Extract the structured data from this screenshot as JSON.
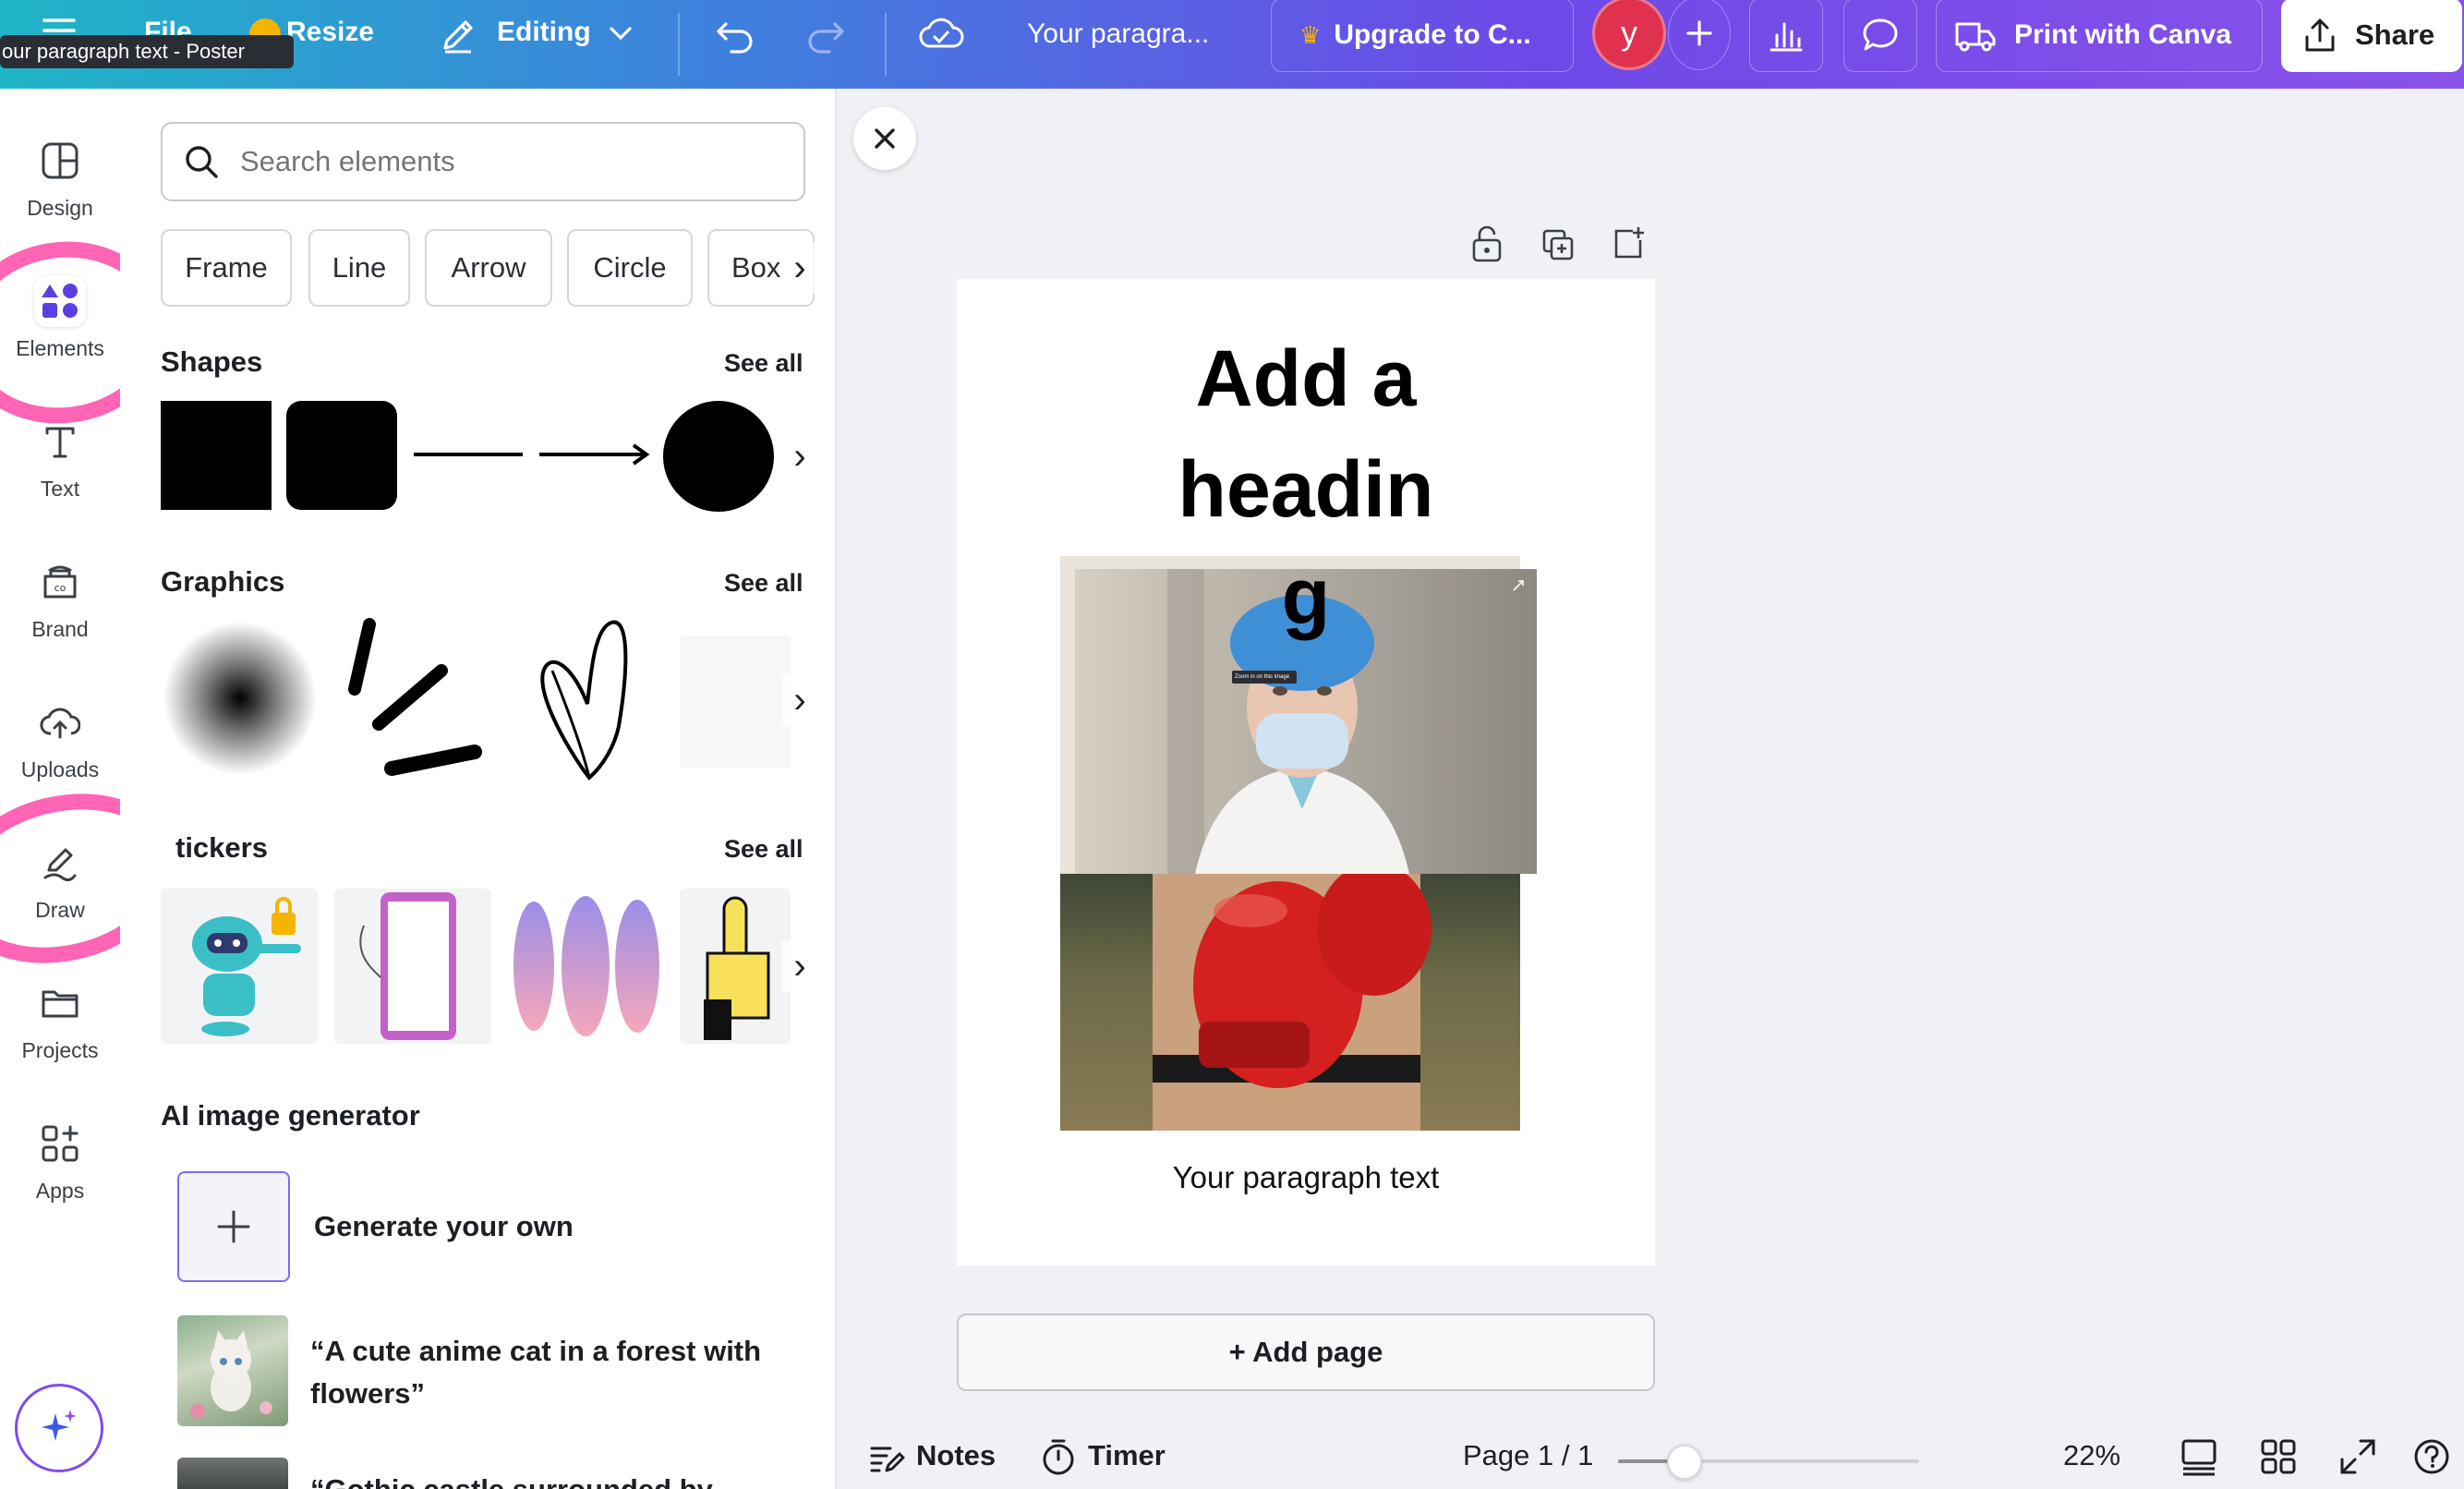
{
  "topbar": {
    "file_label": "File",
    "resize_label": "Resize",
    "editing_label": "Editing",
    "doc_title": "Your paragra...",
    "upgrade_label": "Upgrade to C...",
    "avatar_initial": "y",
    "print_label": "Print with Canva",
    "share_label": "Share",
    "tooltip": "our paragraph text - Poster"
  },
  "rail": {
    "items": [
      {
        "label": "Design"
      },
      {
        "label": "Elements"
      },
      {
        "label": "Text"
      },
      {
        "label": "Brand"
      },
      {
        "label": "Uploads"
      },
      {
        "label": "Draw"
      },
      {
        "label": "Projects"
      },
      {
        "label": "Apps"
      }
    ]
  },
  "panel": {
    "search_placeholder": "Search elements",
    "chips": [
      "Frame",
      "Line",
      "Arrow",
      "Circle",
      "Box"
    ],
    "sections": {
      "shapes": "Shapes",
      "graphics": "Graphics",
      "stickers": "tickers",
      "ai": "AI image generator"
    },
    "see_all": "See all",
    "ai_items": [
      {
        "label": "Generate your own"
      },
      {
        "label": "“A cute anime cat in a forest with flowers”"
      },
      {
        "label": "“Gothic castle surrounded by"
      }
    ]
  },
  "canvas": {
    "heading": "Add a headin",
    "heading_last": "g",
    "image_tip": "Zoom in on this image",
    "paragraph": "Your paragraph text",
    "add_page": "+ Add page"
  },
  "bottom": {
    "notes_label": "Notes",
    "timer_label": "Timer",
    "page_label": "Page 1 / 1",
    "zoom": "22%",
    "zoom_level": 0.22
  },
  "colors": {
    "accent": "#7d2ae8",
    "annotation": "#ff4aa7",
    "avatar": "#e0324f"
  }
}
